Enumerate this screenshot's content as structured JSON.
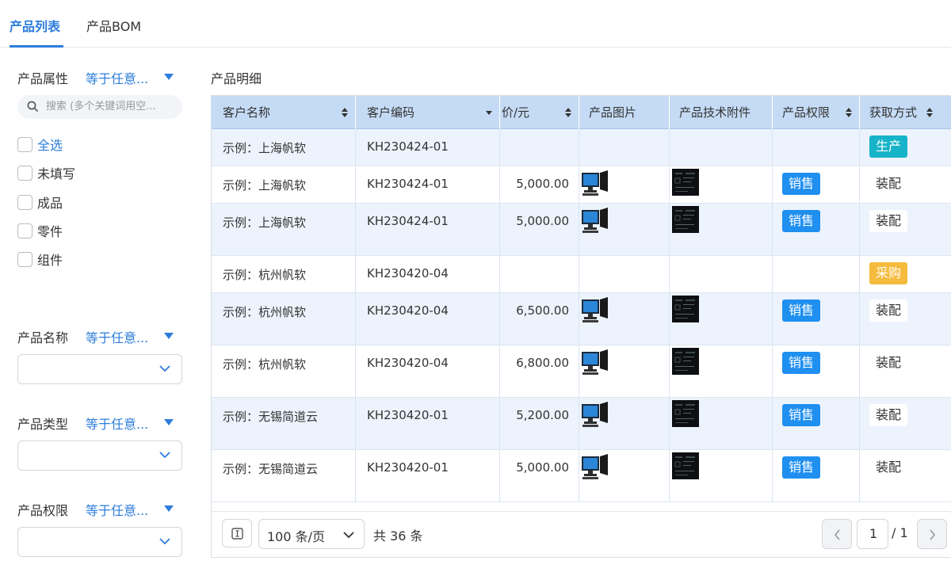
{
  "tabs": {
    "product_list": "产品列表",
    "product_bom": "产品BOM"
  },
  "filters": {
    "attribute": {
      "label": "产品属性",
      "operator": "等于任意..."
    },
    "search_placeholder": "搜索 (多个关键词用空...",
    "options": [
      "全选",
      "未填写",
      "成品",
      "零件",
      "组件"
    ],
    "name": {
      "label": "产品名称",
      "operator": "等于任意..."
    },
    "type": {
      "label": "产品类型",
      "operator": "等于任意..."
    },
    "permission": {
      "label": "产品权限",
      "operator": "等于任意..."
    }
  },
  "table": {
    "title": "产品明细",
    "headers": [
      "客户名称",
      "客户编码",
      "价/元",
      "产品图片",
      "产品技术附件",
      "产品权限",
      "获取方式"
    ],
    "rows": [
      {
        "customer": "示例：上海帆软",
        "code": "KH230424-01",
        "price": "",
        "has_image": false,
        "permission": "",
        "acquire": "生产",
        "acquire_style": "teal"
      },
      {
        "customer": "示例：上海帆软",
        "code": "KH230424-01",
        "price": "5,000.00",
        "has_image": true,
        "permission": "销售",
        "acquire": "装配",
        "acquire_style": "plain"
      },
      {
        "customer": "示例：上海帆软",
        "code": "KH230424-01",
        "price": "5,000.00",
        "has_image": true,
        "permission": "销售",
        "acquire": "装配",
        "acquire_style": "plain"
      },
      {
        "customer": "示例：杭州帆软",
        "code": "KH230420-04",
        "price": "",
        "has_image": false,
        "permission": "",
        "acquire": "采购",
        "acquire_style": "amber"
      },
      {
        "customer": "示例：杭州帆软",
        "code": "KH230420-04",
        "price": "6,500.00",
        "has_image": true,
        "permission": "销售",
        "acquire": "装配",
        "acquire_style": "plain"
      },
      {
        "customer": "示例：杭州帆软",
        "code": "KH230420-04",
        "price": "6,800.00",
        "has_image": true,
        "permission": "销售",
        "acquire": "装配",
        "acquire_style": "plain"
      },
      {
        "customer": "示例：无锡简道云",
        "code": "KH230420-01",
        "price": "5,200.00",
        "has_image": true,
        "permission": "销售",
        "acquire": "装配",
        "acquire_style": "plain"
      },
      {
        "customer": "示例：无锡简道云",
        "code": "KH230420-01",
        "price": "5,000.00",
        "has_image": true,
        "permission": "销售",
        "acquire": "装配",
        "acquire_style": "plain"
      }
    ]
  },
  "pagination": {
    "page_size": "100 条/页",
    "total": "共 36 条",
    "current_page": "1",
    "total_pages": "/ 1"
  },
  "colors": {
    "accent": "#2d7ddb",
    "header_bg": "#c5dbf5",
    "badge_blue": "#1f8ff0",
    "badge_teal": "#17b3c9",
    "badge_amber": "#f5bb3c"
  }
}
